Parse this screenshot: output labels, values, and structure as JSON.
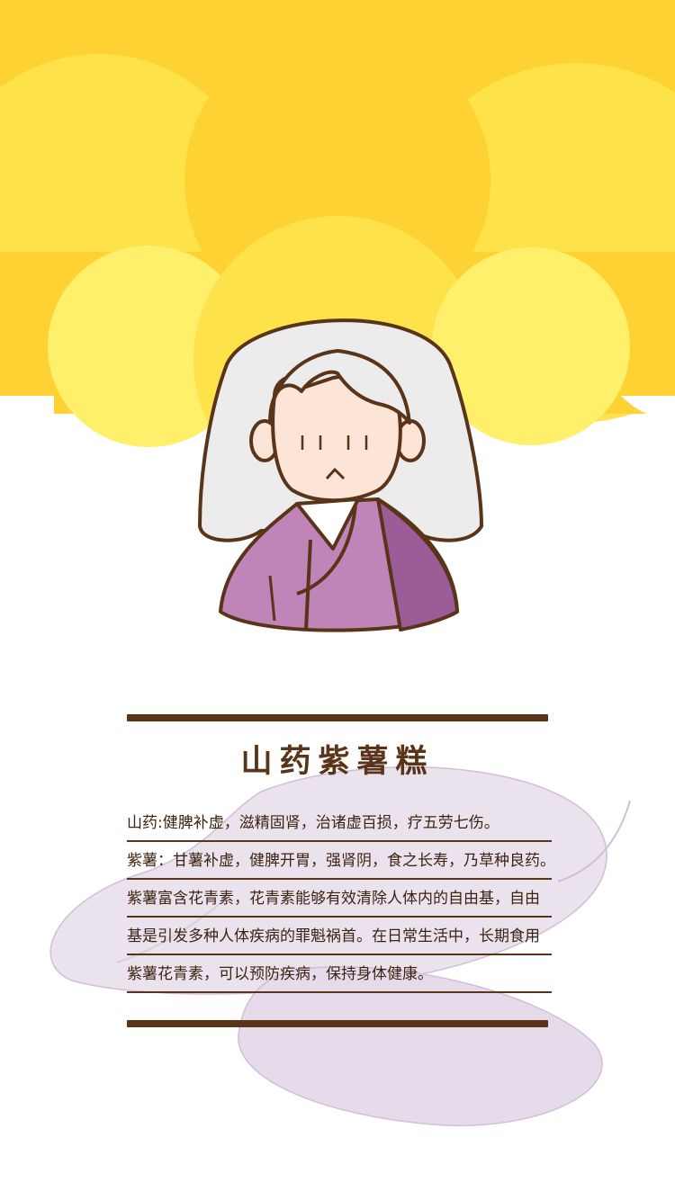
{
  "colors": {
    "sun_dark": "#fdd232",
    "sun_light": "#fff06b",
    "hair": "#ececec",
    "skin": "#fce4d6",
    "robe": "#bf85b8",
    "robe_dark": "#9b5c98",
    "outline": "#5a3418",
    "yam_blob": "#e2d5e6"
  },
  "title": "山药紫薯糕",
  "paragraphs": [
    "山药:健脾补虚，滋精固肾，治诸虚百损，疗五劳七伤。",
    "紫薯：甘薯补虚，健脾开胃，强肾阴，食之长寿，乃草种良药。",
    "紫薯富含花青素，花青素能够有效清除人体内的自由基，自由",
    "基是引发多种人体疾病的罪魁祸首。在日常生活中，长期食用",
    "紫薯花青素，可以预防疾病，保持身体健康。"
  ]
}
